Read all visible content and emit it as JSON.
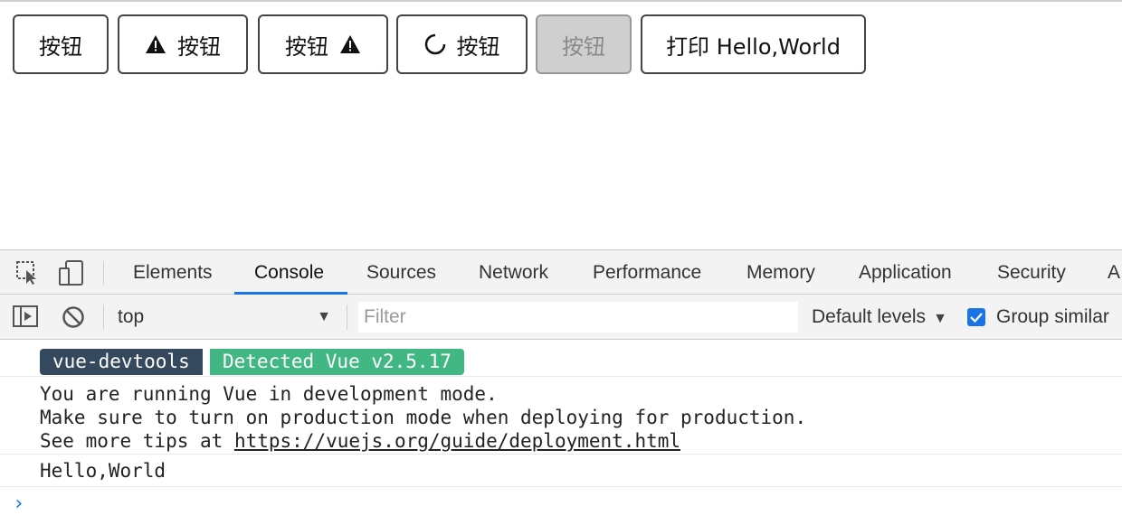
{
  "buttons": [
    {
      "label": "按钮",
      "icon": null
    },
    {
      "label": "按钮",
      "icon": "warning-icon",
      "icon_position": "left"
    },
    {
      "label": "按钮",
      "icon": "warning-icon",
      "icon_position": "right"
    },
    {
      "label": "按钮",
      "icon": "spinner-icon",
      "icon_position": "left"
    },
    {
      "label": "按钮",
      "icon": null,
      "disabled": true
    },
    {
      "label": "打印 Hello,World",
      "icon": null
    }
  ],
  "devtools": {
    "tabs": [
      "Elements",
      "Console",
      "Sources",
      "Network",
      "Performance",
      "Memory",
      "Application",
      "Security",
      "A"
    ],
    "active_tab": "Console",
    "toolbar": {
      "context": "top",
      "filter_placeholder": "Filter",
      "levels": "Default levels",
      "group_similar": "Group similar",
      "group_similar_checked": true
    },
    "console": {
      "badge_left": "vue-devtools",
      "badge_right": "Detected Vue v2.5.17",
      "message_lines": [
        "You are running Vue in development mode.",
        "Make sure to turn on production mode when deploying for production.",
        "See more tips at "
      ],
      "link": "https://vuejs.org/guide/deployment.html",
      "log": "Hello,World",
      "prompt": "›"
    }
  },
  "colors": {
    "accent": "#1a73e8",
    "vue_dark": "#35495e",
    "vue_green": "#41b883",
    "disabled_bg": "#cfcfcf"
  }
}
